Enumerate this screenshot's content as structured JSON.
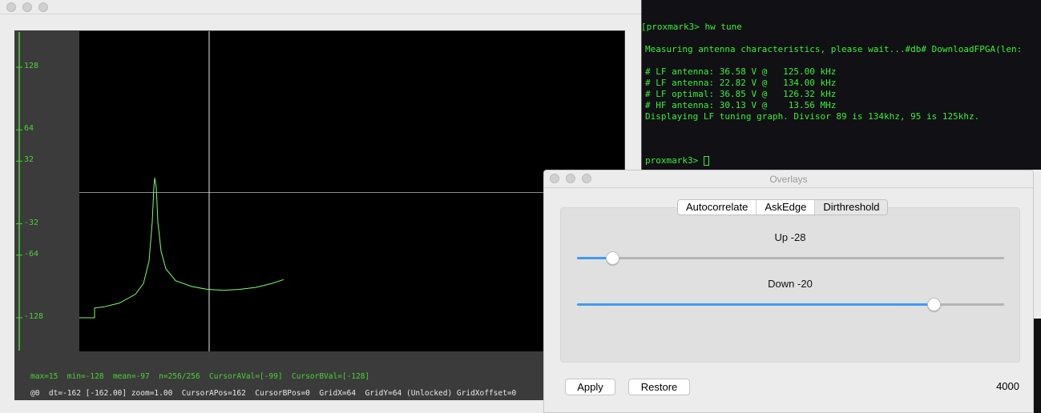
{
  "plot": {
    "y_ticks": [
      "128",
      "64",
      "32",
      "-32",
      "-64",
      "-128"
    ],
    "y_tick_values": [
      128,
      64,
      32,
      -32,
      -64,
      -128
    ],
    "trace_color": "#7dff6a",
    "cursor_a_pos": 162,
    "crosshair_value": 0,
    "trace": [
      [
        0,
        -128
      ],
      [
        19,
        -128
      ],
      [
        19,
        -118
      ],
      [
        30,
        -117
      ],
      [
        50,
        -113
      ],
      [
        70,
        -104
      ],
      [
        80,
        -93
      ],
      [
        87,
        -70
      ],
      [
        91,
        -30
      ],
      [
        93,
        5
      ],
      [
        94,
        15
      ],
      [
        96,
        5
      ],
      [
        98,
        -30
      ],
      [
        102,
        -60
      ],
      [
        108,
        -78
      ],
      [
        120,
        -90
      ],
      [
        140,
        -96
      ],
      [
        160,
        -99
      ],
      [
        180,
        -100
      ],
      [
        200,
        -99
      ],
      [
        220,
        -97
      ],
      [
        240,
        -93
      ],
      [
        255,
        -89
      ]
    ],
    "status1": "max=15  min=-128  mean=-97  n=256/256  CursorAVal=[-99]  CursorBVal=[-128]",
    "status2": "@0  dt=-162 [-162.00] zoom=1.00  CursorAPos=162  CursorBPos=0  GridX=64  GridY=64 (Unlocked) GridXoffset=0"
  },
  "terminal": {
    "lines": [
      "[proxmark3> hw tune",
      "",
      "Measuring antenna characteristics, please wait...#db# DownloadFPGA(len:",
      "",
      "# LF antenna: 36.58 V @   125.00 kHz",
      "# LF antenna: 22.82 V @   134.00 kHz",
      "# LF optimal: 36.85 V @   126.32 kHz",
      "# HF antenna: 30.13 V @    13.56 MHz",
      "Displaying LF tuning graph. Divisor 89 is 134khz, 95 is 125khz."
    ],
    "prompt": "proxmark3> "
  },
  "overlays": {
    "title": "Overlays",
    "tabs": [
      "Autocorrelate",
      "AskEdge",
      "Dirthreshold"
    ],
    "selected_tab": "Dirthreshold",
    "up": {
      "label": "Up  -28",
      "fraction": 0.083
    },
    "down": {
      "label": "Down  -20",
      "fraction": 0.834
    },
    "apply": "Apply",
    "restore": "Restore",
    "value": "4000",
    "accent": "#3d9bf6"
  }
}
